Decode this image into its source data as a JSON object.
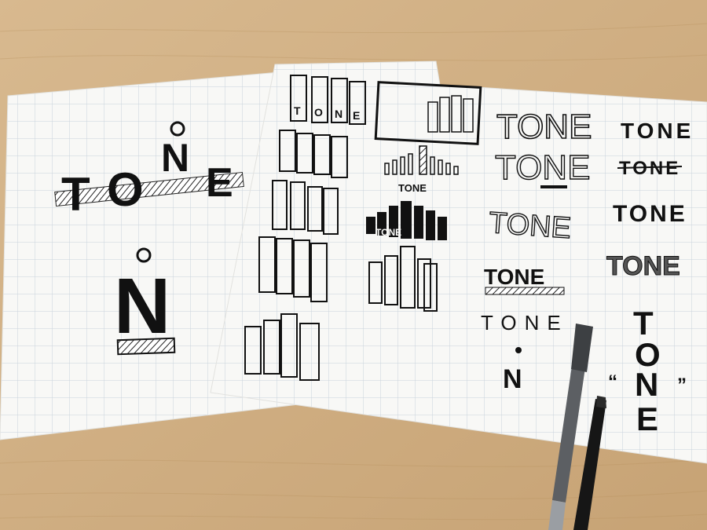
{
  "scene": {
    "alt_subject": "desk-with-logo-sketches",
    "colors": {
      "wood_light": "#d8b98f",
      "wood_dark": "#c7a375",
      "paper": "#f8f8f6",
      "grid": "#c9d2dc",
      "ink": "#111111",
      "pen_grey": "#5c5f63",
      "pen_black": "#161616"
    }
  },
  "sheet_left": {
    "tone_large": {
      "t": "T",
      "o": "O",
      "n": "N",
      "e": "E"
    },
    "n_mark": "N"
  },
  "sheet_right": {
    "word": "TONE",
    "letters": {
      "t": "T",
      "o": "O",
      "n": "N",
      "e": "E"
    },
    "quote_open": "“",
    "quote_close": "”"
  }
}
